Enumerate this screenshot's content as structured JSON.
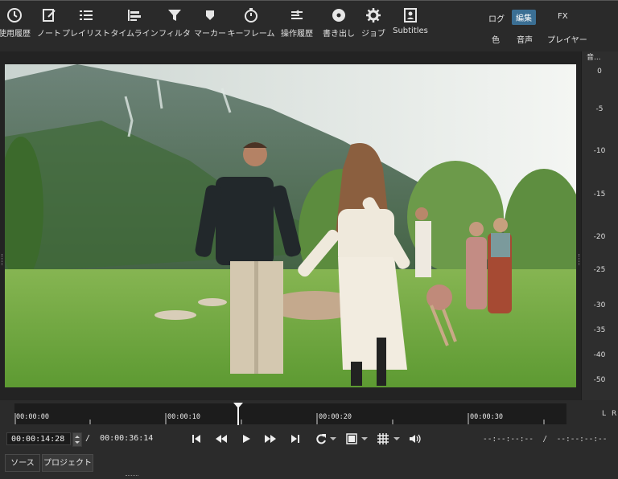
{
  "toolbar": {
    "items": [
      {
        "label": "使用履歴",
        "icon": "clock-icon"
      },
      {
        "label": "ノート",
        "icon": "note-edit-icon"
      },
      {
        "label": "プレイリスト",
        "icon": "playlist-icon"
      },
      {
        "label": "タイムライン",
        "icon": "timeline-icon"
      },
      {
        "label": "フィルタ",
        "icon": "filter-funnel-icon"
      },
      {
        "label": "マーカー",
        "icon": "marker-icon"
      },
      {
        "label": "キーフレーム",
        "icon": "stopwatch-icon"
      },
      {
        "label": "操作履歴",
        "icon": "history-icon"
      },
      {
        "label": "書き出し",
        "icon": "export-disc-icon"
      },
      {
        "label": "ジョブ",
        "icon": "gear-icon"
      },
      {
        "label": "Subtitles",
        "icon": "subtitles-icon"
      }
    ],
    "layouts": {
      "log": "ログ",
      "edit": "編集",
      "fx": "FX",
      "color": "色",
      "audio": "音声",
      "player": "プレイヤー"
    },
    "active_layout": "編集",
    "accent_color": "#3b6f94"
  },
  "meter": {
    "header": "音...",
    "ticks": [
      "0",
      "-5",
      "-10",
      "-15",
      "-20",
      "-25",
      "-30",
      "-35",
      "-40",
      "-50"
    ],
    "channels": {
      "left": "L",
      "right": "R"
    }
  },
  "timeline": {
    "ruler_labels": [
      "00:00:00",
      "00:00:10",
      "00:00:20",
      "00:00:30"
    ]
  },
  "transport": {
    "current_timecode": "00:00:14:28",
    "separator": "/",
    "duration": "00:00:36:14",
    "in_point": "--:--:--:--",
    "out_point": "--:--:--:--",
    "in_out_separator": "/",
    "playhead_fraction": 0.405
  },
  "tabs": {
    "source": "ソース",
    "project": "プロジェクト"
  }
}
